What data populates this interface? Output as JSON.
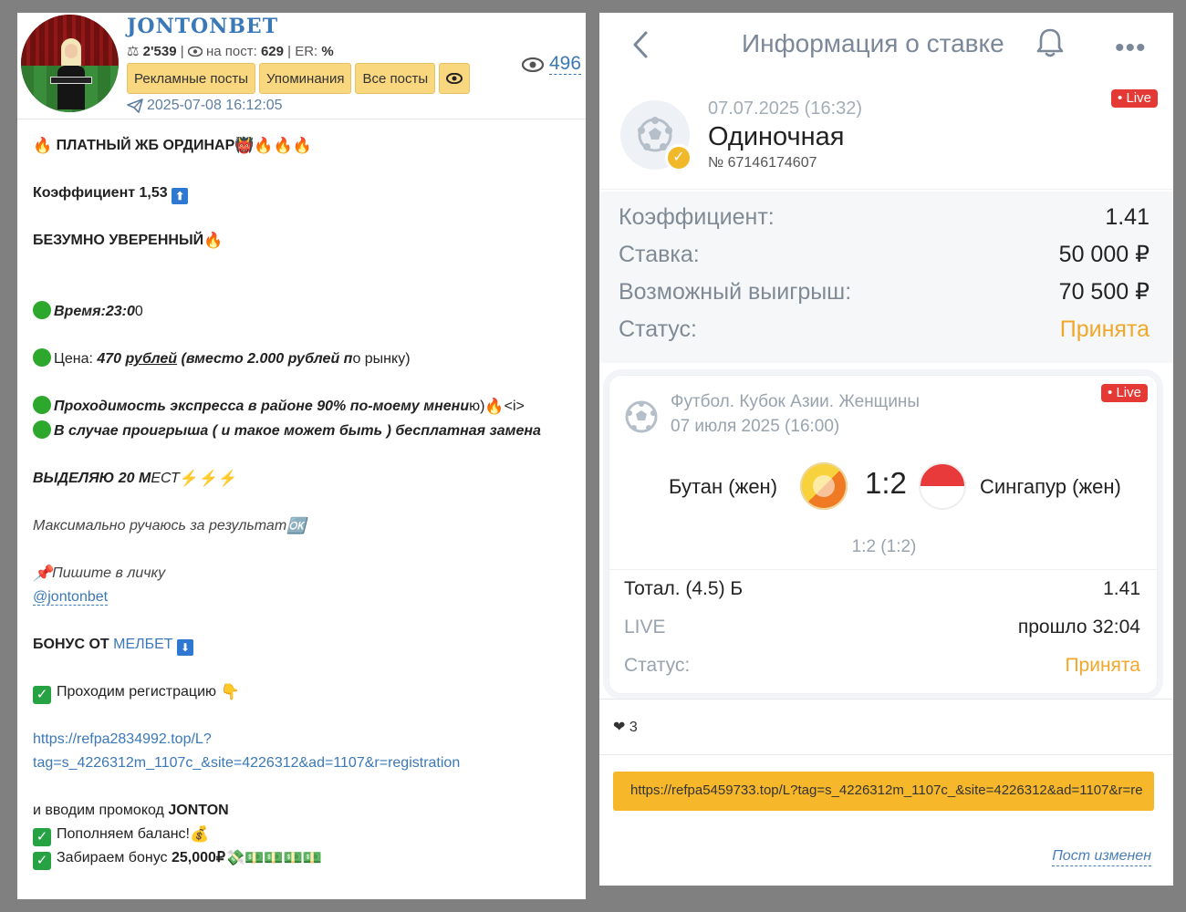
{
  "channel": {
    "title": "JONTONBET",
    "subscribers": "2'539",
    "views_label": "на пост:",
    "views_per_post": "629",
    "er_label": "ER:",
    "er_value": "%",
    "tabs": [
      "Рекламные посты",
      "Упоминания",
      "Все посты"
    ],
    "date": "2025-07-08 16:12:05",
    "views": "496"
  },
  "post": {
    "l1": "ПЛАТНЫЙ ЖБ ОРДИНАР",
    "l2": "Коэффициент 1,53",
    "l3": "БЕЗУМНО УВЕРЕННЫЙ",
    "l4a": "Время:23:0",
    "l4b": "0",
    "l5a": "Цена: ",
    "l5b": "470 ",
    "l5c": "рублей",
    "l5d": " (вместо 2.000 рублей п",
    "l5e": "о рынку)",
    "l6a": "Проходимость экспресса в районе 90% по-моему мнени",
    "l6b": "ю)",
    "l6c": "<i>",
    "l7": "В случае проигрыша ( и такое может быть ) бесплатная замена",
    "l8a": "ВЫДЕЛЯЮ 20 М",
    "l8b": "ЕСТ",
    "l9": "Максимально ручаюсь за результат",
    "l10": "Пишите в личку",
    "l11": "@jontonbet",
    "l12a": "БОНУС ОТ ",
    "l12b": "МЕЛБЕТ",
    "l13": "Проходим регистрацию",
    "l14": "https://refpa2834992.top/L?",
    "l15": "tag=s_4226312m_1107c_&site=4226312&ad=1107&r=registration",
    "l16a": "и вводим промокод ",
    "l16b": "JONTON",
    "l17": "Пополняем баланс!",
    "l18a": "Забираем бонус ",
    "l18b": "25,000₽"
  },
  "bet": {
    "title": "Информация о ставке",
    "date": "07.07.2025 (16:32)",
    "type": "Одиночная",
    "number": "№ 67146174607",
    "live": "Live",
    "coef_label": "Коэффициент:",
    "coef_value": "1.41",
    "stake_label": "Ставка:",
    "stake_value": "50 000 ₽",
    "win_label": "Возможный выигрыш:",
    "win_value": "70 500 ₽",
    "status_label": "Статус:",
    "status_value": "Принята"
  },
  "event": {
    "league": "Футбол. Кубок Азии. Женщины",
    "date": "07 июля 2025 (16:00)",
    "team1": "Бутан (жен)",
    "score": "1:2",
    "team2": "Сингапур (жен)",
    "sub_score": "1:2 (1:2)",
    "market": "Тотал. (4.5) Б",
    "market_coef": "1.41",
    "live_label": "LIVE",
    "elapsed": "прошло 32:04",
    "status_label": "Статус:",
    "status_value": "Принята",
    "live": "Live"
  },
  "footer": {
    "likes": "3",
    "url": "https://refpa5459733.top/L?tag=s_4226312m_1107c_&site=4226312&ad=1107&r=re",
    "edited": "Пост изменен"
  },
  "colors": {
    "accent_blue": "#3a78b8",
    "tab_yellow": "#f9d77e",
    "accepted_orange": "#f1a72a",
    "live_red": "#e53935",
    "url_bar": "#f6b72a"
  }
}
